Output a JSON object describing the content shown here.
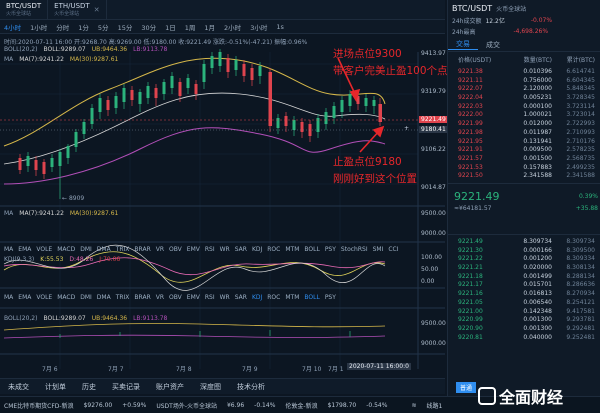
{
  "tabs": [
    {
      "title": "BTC/USDT",
      "sub": "火币全球站",
      "active": true
    },
    {
      "title": "ETH/USDT",
      "sub": "火币全球站",
      "active": false
    }
  ],
  "intervals": [
    "4小时",
    "1小时",
    "分时",
    "1分",
    "5分",
    "15分",
    "30分",
    "1日",
    "1周",
    "1月",
    "2小时",
    "3小时",
    "1s"
  ],
  "info_line": "时间:2020-07-11 16:00  开:9268.70 高:9269.00 低:9180.00 收:9221.49  涨跌:-0.51%(-47.21)  振幅:0.96%",
  "boll_line": {
    "label": "BOLL(20,2)",
    "boll": "BOLL:9289.07",
    "ub": "UB:9464.36",
    "lb": "LB:9113.78"
  },
  "ma_line": {
    "label": "MA",
    "ma7": "MA(7):9241.22",
    "ma30": "MA(30):9287.61"
  },
  "price_labels": [
    "9413.97",
    "9319.79",
    "9221.49",
    "9180.41",
    "9106.22",
    "9014.87"
  ],
  "low_label": "8909",
  "vol_ma_line": {
    "label": "MA",
    "ma7": "MA(7):9241.22",
    "ma30": "MA(30):9287.61"
  },
  "vol_labels": [
    "9500.00",
    "9000.00"
  ],
  "indicators_row": [
    "MA",
    "EMA",
    "VOLE",
    "MACD",
    "DMI",
    "DMA",
    "TRIX",
    "BRAR",
    "VR",
    "OBV",
    "EMV",
    "RSI",
    "WR",
    "SAR",
    "KDJ",
    "ROC",
    "MTM",
    "BOLL",
    "PSY",
    "StochRSI",
    "SMI",
    "CCI"
  ],
  "kdj_line": {
    "label": "KDJ(9,3,3)",
    "k": "K:55.53",
    "d": "D:48.26",
    "j": "J:70.06"
  },
  "kdj_labels": [
    "100.00",
    "50.00",
    "0.00"
  ],
  "indicators_row2": [
    "MA",
    "EMA",
    "VOLE",
    "MACD",
    "DMI",
    "DMA",
    "TRIX",
    "BRAR",
    "VR",
    "OBV",
    "EMV",
    "RSI",
    "WR",
    "SAR",
    "KDJ",
    "ROC",
    "MTM",
    "BOLL",
    "PSY"
  ],
  "boll2_line": {
    "label": "BOLL(20,2)",
    "boll": "BOLL:9289.07",
    "ub": "UB:9464.36",
    "lb": "LB:9113.78"
  },
  "boll2_labels": [
    "9500.00",
    "9000.00"
  ],
  "date_labels": [
    "7月 6",
    "7月 7",
    "7月 8",
    "7月 9",
    "7月 10",
    "7月 1"
  ],
  "cursor_date": "2020-07-11 16:00:0",
  "annotations": {
    "take_profit_1": "进场点位9300",
    "take_profit_2": "带客户完美止盈100个点位",
    "stop_1": "止盈点位9180",
    "stop_2": "刚刚好到这个位置"
  },
  "bottom_tabs": [
    "未成交",
    "计划单",
    "历史",
    "买卖记录",
    "账户资产",
    "深度图",
    "技术分析"
  ],
  "ticker": [
    {
      "name": "CME比特币期货CFD-新浪",
      "price": "$9276.00",
      "chg": "+0.59%",
      "dir": "up"
    },
    {
      "name": "USDT场外-火币全球站",
      "price": "¥6.96",
      "chg": "-0.14%",
      "dir": "dn"
    },
    {
      "name": "伦敦金-新浪",
      "price": "$1798.70",
      "chg": "-0.54%",
      "dir": "dn"
    }
  ],
  "status": {
    "connected": "线路1",
    "badge": "普通"
  },
  "watermark": "全面财经",
  "right_panel": {
    "pair": "BTC/USDT",
    "exchange": "火币全球站",
    "change_pct": "-0.07%",
    "change_abs": "-4,698.26%",
    "vol_label": "24h成交额",
    "vol_value": "12.2亿",
    "high_label": "24h最高",
    "tabs": [
      "交易",
      "成交"
    ],
    "cols": [
      "价格(USDT)",
      "数量(BTC)",
      "累计(BTC)"
    ],
    "asks": [
      {
        "p": "9221.38",
        "a": "0.010396",
        "t": "6.614741"
      },
      {
        "p": "9221.11",
        "a": "0.756000",
        "t": "6.604345"
      },
      {
        "p": "9222.07",
        "a": "2.120000",
        "t": "5.848345"
      },
      {
        "p": "9222.04",
        "a": "0.005231",
        "t": "3.728345"
      },
      {
        "p": "9222.03",
        "a": "0.000100",
        "t": "3.723114"
      },
      {
        "p": "9222.00",
        "a": "1.000021",
        "t": "3.723014"
      },
      {
        "p": "9221.99",
        "a": "0.012000",
        "t": "2.722993"
      },
      {
        "p": "9221.98",
        "a": "0.011987",
        "t": "2.710993"
      },
      {
        "p": "9221.95",
        "a": "0.131941",
        "t": "2.710176"
      },
      {
        "p": "9221.91",
        "a": "0.009500",
        "t": "2.578235"
      },
      {
        "p": "9221.57",
        "a": "0.001500",
        "t": "2.568735"
      },
      {
        "p": "9221.53",
        "a": "0.157883",
        "t": "2.499235"
      },
      {
        "p": "9221.50",
        "a": "2.341588",
        "t": "2.341588"
      }
    ],
    "last_price": "9221.49",
    "last_sub": "≈¥64181.57",
    "last_pct": "0.39%",
    "last_delta": "+35.88",
    "bids": [
      {
        "p": "9221.49",
        "a": "8.309734",
        "t": "8.309734"
      },
      {
        "p": "9221.30",
        "a": "0.000166",
        "t": "8.309500"
      },
      {
        "p": "9221.22",
        "a": "0.001200",
        "t": "8.309334"
      },
      {
        "p": "9221.21",
        "a": "0.020000",
        "t": "8.308134"
      },
      {
        "p": "9221.18",
        "a": "0.001499",
        "t": "8.288134"
      },
      {
        "p": "9221.17",
        "a": "0.015701",
        "t": "8.286636"
      },
      {
        "p": "9221.16",
        "a": "0.016813",
        "t": "8.270934"
      },
      {
        "p": "9221.05",
        "a": "0.006540",
        "t": "8.254121"
      },
      {
        "p": "9221.00",
        "a": "0.142348",
        "t": "9.417581"
      },
      {
        "p": "9220.99",
        "a": "0.001300",
        "t": "9.293781"
      },
      {
        "p": "9220.90",
        "a": "0.001300",
        "t": "9.292481"
      },
      {
        "p": "9220.81",
        "a": "0.040000",
        "t": "9.252481"
      }
    ]
  },
  "colors": {
    "up": "#2bb37c",
    "down": "#e0444e",
    "accent": "#2f8ef0",
    "annotation": "#e6272b"
  }
}
